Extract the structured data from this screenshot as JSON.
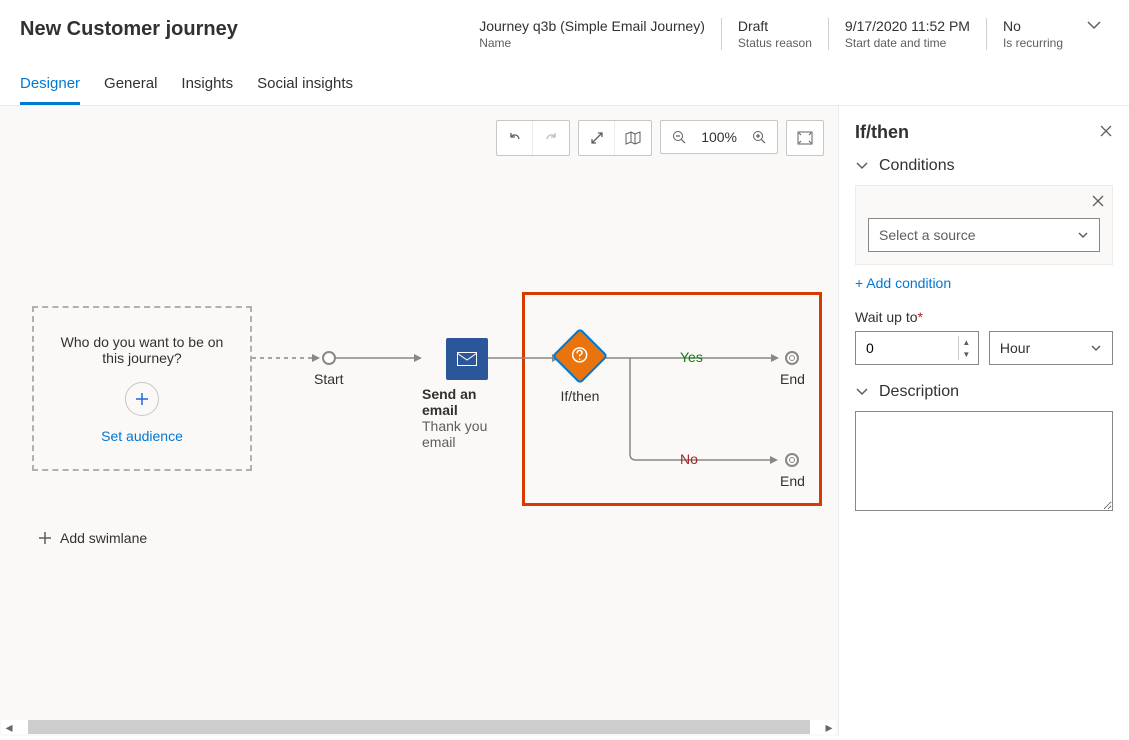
{
  "header": {
    "title": "New Customer journey",
    "fields": [
      {
        "value": "Journey q3b (Simple Email Journey)",
        "label": "Name"
      },
      {
        "value": "Draft",
        "label": "Status reason"
      },
      {
        "value": "9/17/2020 11:52 PM",
        "label": "Start date and time"
      },
      {
        "value": "No",
        "label": "Is recurring"
      }
    ]
  },
  "tabs": [
    "Designer",
    "General",
    "Insights",
    "Social insights"
  ],
  "toolbar": {
    "zoom_text": "100%"
  },
  "canvas": {
    "audience_question": "Who do you want to be on this journey?",
    "set_audience_label": "Set audience",
    "start_label": "Start",
    "email_title": "Send an email",
    "email_subtitle": "Thank you email",
    "ifthen_label": "If/then",
    "yes_label": "Yes",
    "no_label": "No",
    "end_label": "End",
    "add_swimlane_label": "Add swimlane"
  },
  "panel": {
    "title": "If/then",
    "conditions_label": "Conditions",
    "select_source_placeholder": "Select a source",
    "add_condition_label": "+ Add condition",
    "wait_label": "Wait up to",
    "wait_value": "0",
    "wait_unit": "Hour",
    "description_label": "Description",
    "description_value": ""
  }
}
